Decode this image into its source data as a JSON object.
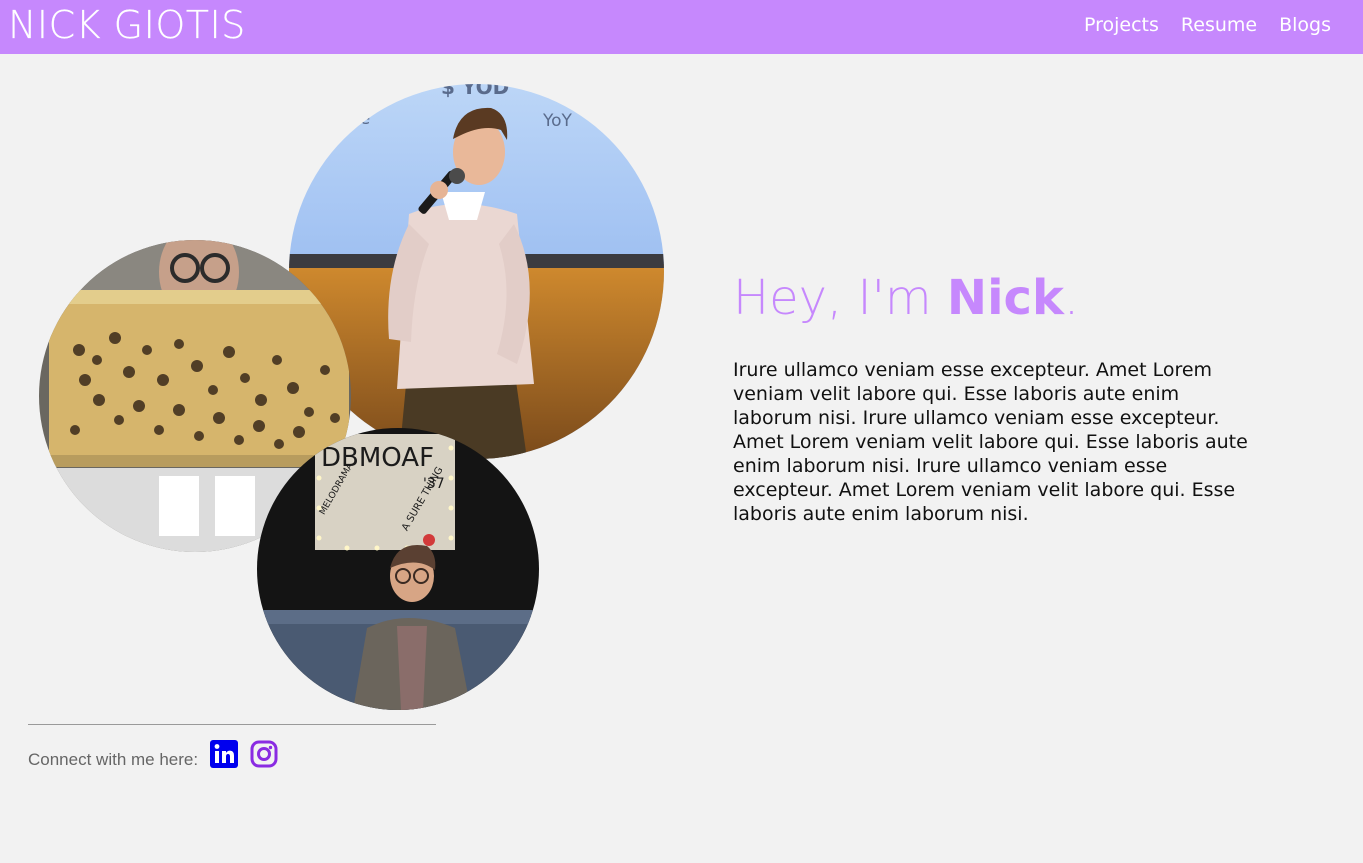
{
  "header": {
    "brand": "NICK GIOTIS",
    "nav": [
      {
        "label": "Projects"
      },
      {
        "label": "Resume"
      },
      {
        "label": "Blogs"
      }
    ]
  },
  "hero": {
    "greeting": "Hey, I'm ",
    "name": "Nick",
    "punctuation": ".",
    "intro": "Irure ullamco veniam esse excepteur. Amet Lorem veniam velit labore qui. Esse laboris aute enim laborum nisi. Irure ullamco veniam esse excepteur. Amet Lorem veniam velit labore qui. Esse laboris aute enim laborum nisi. Irure ullamco veniam esse excepteur. Amet Lorem veniam velit labore qui. Esse laboris aute enim laborum nisi."
  },
  "photos": {
    "stage_sign_text": [
      "$ YOD",
      "ue",
      "YoY"
    ],
    "poster_text": [
      "DBMOAF",
      "'37",
      "MELODRAMA",
      "A SURE THING"
    ]
  },
  "footer": {
    "connect_label": "Connect with me here:",
    "socials": [
      {
        "icon": "linkedin-icon",
        "color": "#0000ee"
      },
      {
        "icon": "instagram-icon",
        "color": "#8a2be2"
      }
    ]
  },
  "colors": {
    "accent": "#c688fd",
    "background": "#f2f2f2",
    "text": "#111111"
  }
}
